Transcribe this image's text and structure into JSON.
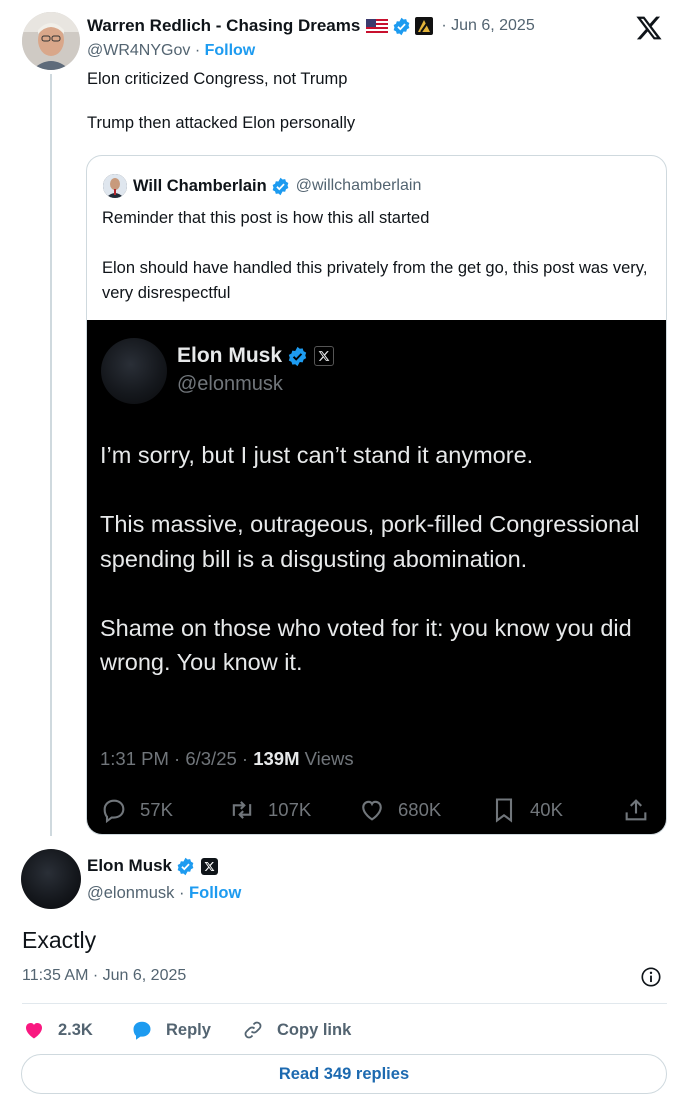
{
  "parent": {
    "author_name": "Warren Redlich - Chasing Dreams",
    "date": "· Jun 6, 2025",
    "handle": "@WR4NYGov",
    "separator": " · ",
    "follow_label": "Follow",
    "text": "Elon criticized Congress, not Trump\n\nTrump then attacked Elon personally",
    "icons": [
      "us-flag-icon",
      "verified-badge-icon",
      "affiliate-badge-icon",
      "x-logo-icon"
    ]
  },
  "quote": {
    "author_name": "Will Chamberlain",
    "handle": "@willchamberlain",
    "text": "Reminder that this post is how this all started\n\nElon should have handled this privately from the get go, this post was very, very disrespectful",
    "embedded": {
      "author_name": "Elon Musk",
      "handle": "@elonmusk",
      "text": "I’m sorry, but I just can’t stand it anymore.\n\nThis massive, outrageous, pork-filled Congressional spending bill is a disgusting abomination.\n\nShame on those who voted for it: you know you did wrong. You know it.",
      "meta_time": "1:31 PM · 6/3/25 · ",
      "meta_views": "139M",
      "meta_views_label": " Views",
      "actions": {
        "replies": "57K",
        "reposts": "107K",
        "likes": "680K",
        "bookmarks": "40K"
      }
    }
  },
  "main": {
    "author_name": "Elon Musk",
    "handle": "@elonmusk",
    "separator": " · ",
    "follow_label": "Follow",
    "text": "Exactly",
    "timestamp": "11:35 AM · Jun 6, 2025",
    "actions": {
      "likes": "2.3K",
      "reply_label": "Reply",
      "copy_label": "Copy link"
    },
    "read_replies_label": "Read 349 replies"
  },
  "colors": {
    "accent": "#1d9bf0",
    "like": "#f91880",
    "text": "#0f1419",
    "muted": "#536471"
  }
}
